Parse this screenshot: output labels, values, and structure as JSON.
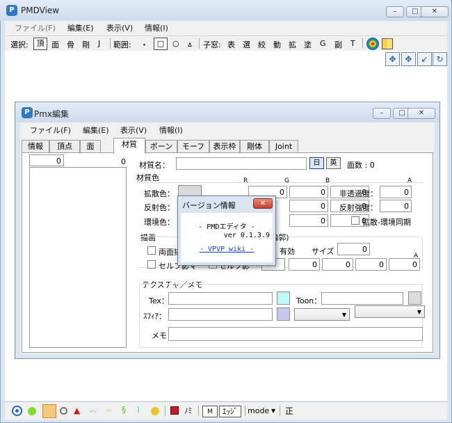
{
  "main": {
    "title": "PMDView",
    "menu": [
      "ファイル(F)",
      "編集(E)",
      "表示(V)",
      "情報(I)"
    ],
    "toolbar": {
      "select_label": "選択:",
      "select_items": [
        "頂",
        "面",
        "骨",
        "剛",
        "J"
      ],
      "range_label": "範囲:",
      "range_items": [
        "・",
        "□",
        "○",
        "ㅿ"
      ],
      "child_label": "子窓:",
      "child_items": [
        "表",
        "選",
        "絞",
        "動",
        "拡",
        "塗",
        "G",
        "副",
        "T"
      ]
    },
    "window_controls": {
      "minimize": "–",
      "maximize": "□",
      "close": "✕"
    },
    "status": {
      "mode_label": "mode",
      "edge_label": "ｴｯｼﾞ",
      "nomi_label": "ﾉﾐ",
      "sei_label": "正"
    }
  },
  "pmx": {
    "title": "Pmx編集",
    "menu": [
      "ファイル(F)",
      "編集(E)",
      "表示(V)",
      "情報(I)"
    ],
    "tabs": [
      "情報",
      "頂点",
      "面",
      "材質",
      "ボーン",
      "モーフ",
      "表示枠",
      "剛体",
      "Joint"
    ],
    "active_tab": "材質",
    "material": {
      "list_index": "0",
      "count": "0",
      "name_label": "材質名：",
      "jp_btn": "日",
      "en_btn": "英",
      "face_count": "面数 : 0",
      "color_group": "材質色",
      "col_r": "R",
      "col_g": "G",
      "col_b": "B",
      "col_a": "A",
      "diffuse_label": "拡散色：",
      "specular_label": "反射色：",
      "ambient_label": "環境色：",
      "opacity_label": "非透過度：",
      "spec_strength_label": "反射強度：",
      "sync_label": "拡散-環境同期",
      "zero": "0",
      "draw_group": "描画",
      "double_side": "両面描",
      "self_shadow_map": "セルフ影マ",
      "self_shadow": "セルフ影",
      "edge_group": "ジ(輪郭)",
      "edge_enabled": "有効",
      "size_label": "サイズ",
      "tex_group": "テクスチャ／メモ",
      "tex_label": "Tex：",
      "toon_label": "Toon：",
      "sphere_label": "ｽﾌｨｱ：",
      "memo_label": "メモ："
    }
  },
  "dialog": {
    "title": "バージョン情報",
    "close": "✕",
    "line1": "- PMDエディタ -",
    "line2": "ver 0.1.3.9",
    "link": "- VPVP wiki -"
  },
  "colors": {
    "tex_swatch": "#bff8fa",
    "sphere_swatch": "#c8c8ef",
    "toon_swatch": "#dcdcdc",
    "link": "#1a3fcf"
  }
}
